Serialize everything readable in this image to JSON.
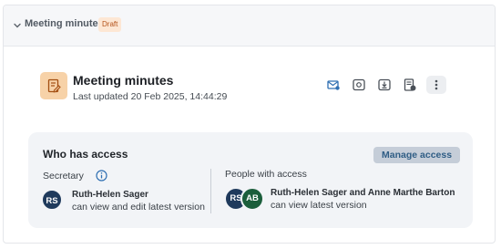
{
  "header": {
    "title": "Meeting minutes",
    "badge": "Draft"
  },
  "document": {
    "title": "Meeting minutes",
    "updated": "Last updated 20 Feb 2025, 14:44:29"
  },
  "toolbar": {
    "icons": [
      "mail-icon",
      "preview-icon",
      "download-icon",
      "report-icon",
      "more-icon"
    ]
  },
  "access": {
    "title": "Who has access",
    "manage_label": "Manage access",
    "secretary": {
      "label": "Secretary",
      "initials": "RS",
      "name": "Ruth-Helen Sager",
      "permission": "can view and edit latest version"
    },
    "people": {
      "label": "People with access",
      "avatars": [
        "RS",
        "AB"
      ],
      "names": "Ruth-Helen Sager and Anne Marthe Barton",
      "permission": "can view latest version"
    }
  },
  "colors": {
    "accent": "#2f6fb2",
    "badge_bg": "#fde7d4",
    "badge_text": "#b4531b",
    "doc_icon_bg": "#f7d2a8",
    "avatar_rs": "#1f3a5c",
    "avatar_ab": "#1b5e3b"
  }
}
